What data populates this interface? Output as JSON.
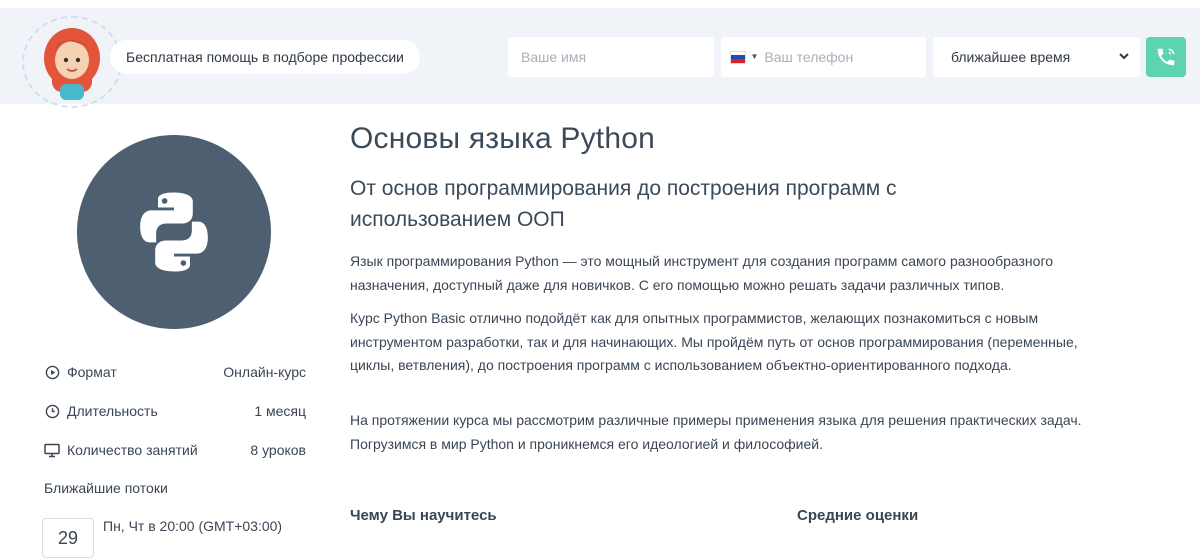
{
  "header": {
    "help_text": "Бесплатная помощь в подборе профессии",
    "name_placeholder": "Ваше имя",
    "phone_placeholder": "Ваш телефон",
    "time_select_value": "ближайшее время",
    "accent_color": "#5dd3b0"
  },
  "course": {
    "title": "Основы языка Python",
    "subtitle": "От основ программирования до построения программ с использованием ООП",
    "paragraphs": [
      "Язык программирования Python — это мощный инструмент для создания программ самого разнообразного назначения, доступный даже для новичков. С его помощью можно решать задачи различных типов.",
      "Курс Python Basic отлично подойдёт как для опытных программистов, желающих познакомиться с новым инструментом разработки, так и для начинающих. Мы пройдём путь от основ программирования (переменные, циклы, ветвления), до построения программ с использованием объектно-ориентированного подхода.",
      "На протяжении курса мы рассмотрим различные примеры применения языка для решения практических задач. Погрузимся в мир Python и проникнемся его идеологией и философией."
    ],
    "learn_heading": "Чему Вы научитесь",
    "ratings_heading": "Средние оценки"
  },
  "meta": {
    "format_label": "Формат",
    "format_value": "Онлайн-курс",
    "duration_label": "Длительность",
    "duration_value": "1 месяц",
    "lessons_label": "Количество занятий",
    "lessons_value": "8 уроков",
    "streams_title": "Ближайшие потоки",
    "stream_day": "29",
    "stream_schedule": "Пн, Чт в 20:00 (GMT+03:00)"
  },
  "icons": {
    "logo": "python-logo-icon",
    "format": "play-circle-icon",
    "duration": "clock-icon",
    "lessons": "monitor-icon",
    "call": "phone-icon",
    "flag": "russia-flag-icon"
  }
}
